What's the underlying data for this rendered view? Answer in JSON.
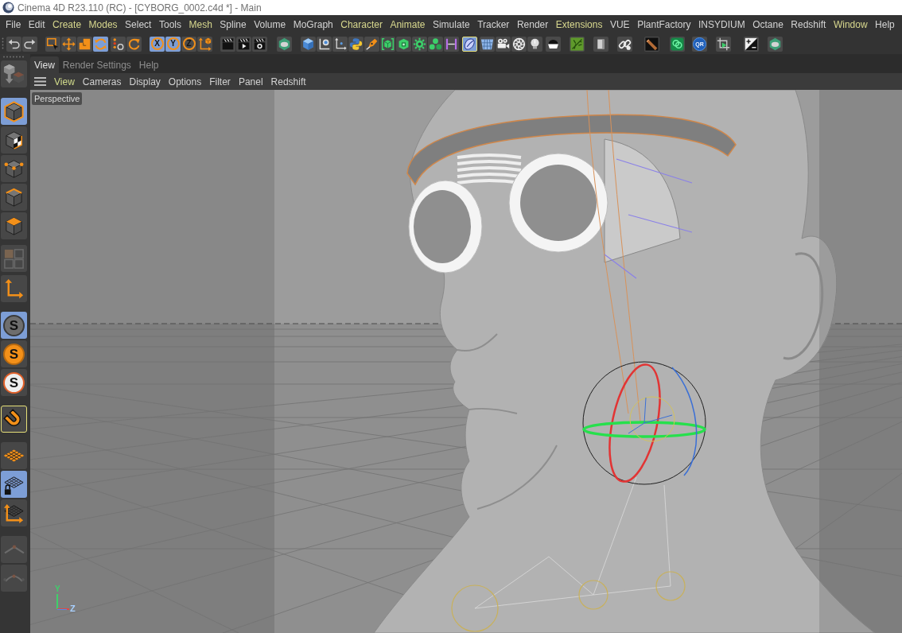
{
  "window": {
    "title": "Cinema 4D R23.110 (RC) - [CYBORG_0002.c4d *] - Main"
  },
  "menu_bar": [
    {
      "label": "File",
      "highlighted": false
    },
    {
      "label": "Edit",
      "highlighted": false
    },
    {
      "label": "Create",
      "highlighted": true
    },
    {
      "label": "Modes",
      "highlighted": true
    },
    {
      "label": "Select",
      "highlighted": false
    },
    {
      "label": "Tools",
      "highlighted": false
    },
    {
      "label": "Mesh",
      "highlighted": true
    },
    {
      "label": "Spline",
      "highlighted": false
    },
    {
      "label": "Volume",
      "highlighted": false
    },
    {
      "label": "MoGraph",
      "highlighted": false
    },
    {
      "label": "Character",
      "highlighted": true
    },
    {
      "label": "Animate",
      "highlighted": true
    },
    {
      "label": "Simulate",
      "highlighted": false
    },
    {
      "label": "Tracker",
      "highlighted": false
    },
    {
      "label": "Render",
      "highlighted": false
    },
    {
      "label": "Extensions",
      "highlighted": true
    },
    {
      "label": "VUE",
      "highlighted": false
    },
    {
      "label": "PlantFactory",
      "highlighted": false
    },
    {
      "label": "INSYDIUM",
      "highlighted": false
    },
    {
      "label": "Octane",
      "highlighted": false
    },
    {
      "label": "Redshift",
      "highlighted": false
    },
    {
      "label": "Window",
      "highlighted": true
    },
    {
      "label": "Help",
      "highlighted": false
    }
  ],
  "toolbar": [
    [
      {
        "active": false,
        "outlined": false
      },
      {
        "active": false,
        "outlined": false
      }
    ],
    [
      {
        "active": false,
        "outlined": false
      },
      {
        "active": false,
        "outlined": false
      },
      {
        "active": false,
        "outlined": false
      },
      {
        "active": true,
        "outlined": false
      }
    ],
    [
      {
        "active": false,
        "outlined": false
      }
    ],
    [
      {
        "active": false,
        "outlined": false
      }
    ],
    [
      {
        "label": "X",
        "active": true,
        "outlined": false
      },
      {
        "label": "Y",
        "active": true,
        "outlined": false
      },
      {
        "label": "Z",
        "active": false,
        "outlined": false
      },
      {
        "active": false,
        "outlined": false
      }
    ],
    [
      {
        "active": false,
        "outlined": false
      },
      {
        "active": false,
        "outlined": false
      },
      {
        "active": false,
        "outlined": false
      }
    ],
    [
      {
        "active": false,
        "outlined": false
      }
    ],
    [
      {
        "active": false,
        "outlined": false
      },
      {
        "active": false,
        "outlined": false
      },
      {
        "active": false,
        "outlined": false
      },
      {
        "active": false,
        "outlined": false
      },
      {
        "active": false,
        "outlined": false
      },
      {
        "active": false,
        "outlined": false
      },
      {
        "active": false,
        "outlined": false
      },
      {
        "active": false,
        "outlined": false
      },
      {
        "active": false,
        "outlined": false
      },
      {
        "active": false,
        "outlined": false
      }
    ],
    [
      {
        "active": true,
        "outlined": true
      }
    ],
    [
      {
        "active": false,
        "outlined": false
      },
      {
        "active": false,
        "outlined": false
      },
      {
        "active": false,
        "outlined": false
      },
      {
        "active": false,
        "outlined": false
      }
    ],
    [
      {
        "active": false,
        "outlined": false
      }
    ],
    [
      {
        "active": false,
        "outlined": false
      }
    ],
    [
      {
        "active": false,
        "outlined": false
      }
    ],
    [
      {
        "active": false,
        "outlined": false
      }
    ],
    [
      {
        "active": false,
        "outlined": false
      }
    ],
    [
      {
        "active": false,
        "outlined": false
      }
    ],
    [
      {
        "label": "QR",
        "active": false,
        "outlined": false
      }
    ],
    [
      {
        "active": false,
        "outlined": false
      }
    ],
    [
      {
        "active": false,
        "outlined": false
      }
    ],
    [
      {
        "active": false,
        "outlined": false
      }
    ]
  ],
  "left_toolbar": [
    [
      {
        "active": false,
        "outlined": false
      }
    ],
    [
      {
        "active": true,
        "outlined": false
      },
      {
        "active": false,
        "outlined": false
      },
      {
        "active": false,
        "outlined": false
      },
      {
        "active": false,
        "outlined": false
      },
      {
        "active": false,
        "outlined": false
      }
    ],
    [
      {
        "active": false,
        "outlined": false
      }
    ],
    [
      {
        "active": false,
        "outlined": false
      }
    ],
    [
      {
        "label": "S",
        "active": true,
        "outlined": false
      },
      {
        "label": "S",
        "active": false,
        "outlined": false
      },
      {
        "label": "S",
        "active": false,
        "outlined": false
      }
    ],
    [
      {
        "active": false,
        "outlined": true
      }
    ],
    [
      {
        "active": false,
        "outlined": false
      },
      {
        "active": true,
        "outlined": false
      },
      {
        "active": false,
        "outlined": false
      }
    ],
    [
      {
        "active": false,
        "outlined": false
      },
      {
        "active": false,
        "outlined": false
      }
    ]
  ],
  "viewport": {
    "tabs": [
      {
        "label": "View",
        "selected": true
      },
      {
        "label": "Render Settings",
        "selected": false
      },
      {
        "label": "Help",
        "selected": false
      }
    ],
    "menu": [
      {
        "label": "View",
        "highlighted": true
      },
      {
        "label": "Cameras",
        "highlighted": false
      },
      {
        "label": "Display",
        "highlighted": false
      },
      {
        "label": "Options",
        "highlighted": false
      },
      {
        "label": "Filter",
        "highlighted": false
      },
      {
        "label": "Panel",
        "highlighted": false
      },
      {
        "label": "Redshift",
        "highlighted": false
      }
    ],
    "camera_label": "Perspective",
    "axis_labels": [
      "Y",
      "Z"
    ]
  }
}
